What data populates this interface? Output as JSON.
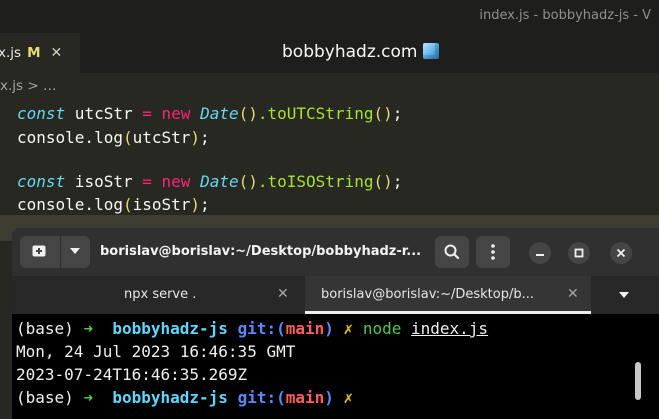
{
  "window": {
    "title": "index.js - bobbyhadz-js - V"
  },
  "editor": {
    "tab": {
      "filename": "x.js",
      "badge": "M",
      "close": "✕"
    },
    "watermark": "bobbyhadz.com",
    "breadcrumb": "x.js > …",
    "lines": [
      {
        "kw": "const",
        "ident": " utcStr ",
        "op1": "=",
        "sp": " ",
        "op2": "new",
        "sp2": " ",
        "type": "Date",
        "p1": "()",
        "rest": ".toUTCString",
        "p2": "()",
        "end": ";"
      },
      {
        "text": "console.log",
        "p1": "(",
        "arg": "utcStr",
        "p2": ")",
        "end": ";"
      },
      {
        "kw": "const",
        "ident": " isoStr ",
        "op1": "=",
        "sp": " ",
        "op2": "new",
        "sp2": " ",
        "type": "Date",
        "p1": "()",
        "rest": ".toISOString",
        "p2": "()",
        "end": ";"
      },
      {
        "text": "console.log",
        "p1": "(",
        "arg": "isoStr",
        "p2": ")",
        "end": ";"
      }
    ]
  },
  "terminal": {
    "title": "borislav@borislav:~/Desktop/bobbyhadz-r...",
    "tabs": [
      {
        "label": "npx serve .",
        "close": "✕"
      },
      {
        "label": "borislav@borislav:~/Desktop/b...",
        "close": "✕"
      }
    ],
    "output": {
      "line1": {
        "base": "(base) ",
        "arrow": "➜",
        "dir": "  bobbyhadz-js ",
        "git": "git:(",
        "branch": "main",
        "git_close": ")",
        "dirty": " ✗ ",
        "cmd": "node ",
        "arg": "index.js"
      },
      "line2": "Mon, 24 Jul 2023 16:46:35 GMT",
      "line3": "2023-07-24T16:46:35.269Z",
      "line4": {
        "base": "(base) ",
        "arrow": "➜",
        "dir": "  bobbyhadz-js ",
        "git": "git:(",
        "branch": "main",
        "git_close": ")",
        "dirty": " ✗"
      }
    }
  }
}
